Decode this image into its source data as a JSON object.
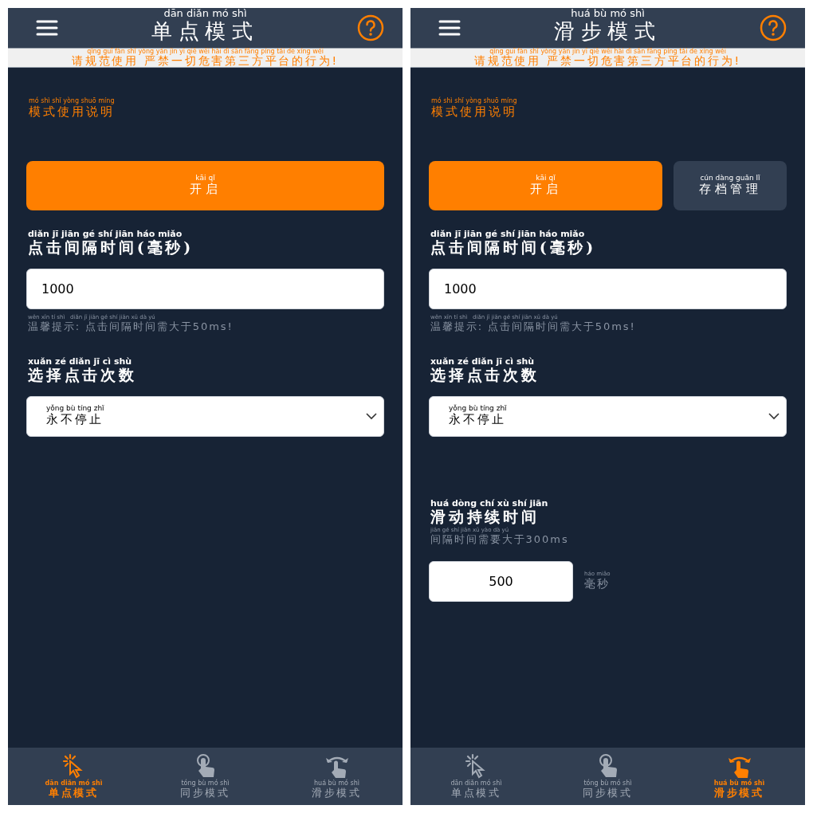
{
  "screens": [
    {
      "title": {
        "pinyin": "dān diǎn mó shì",
        "text": "单点模式"
      },
      "notice": {
        "pinyin": "qǐng guī fàn shǐ yòng yán jìn yī qiē wēi hài dì sān fāng píng tái de xíng wéi",
        "text": "请规范使用 严禁一切危害第三方平台的行为!"
      },
      "help_link": {
        "pinyin": "mó shì shǐ yòng shuō míng",
        "text": "模式使用说明"
      },
      "buttons": [
        {
          "pinyin": "kāi qǐ",
          "text": "开启",
          "kind": "primary"
        }
      ],
      "interval": {
        "label": {
          "pinyin": "diǎn jī jiān gé shí jiān háo miǎo",
          "text": "点击间隔时间(毫秒)"
        },
        "value": "1000",
        "hint": {
          "pinyin": "wēn xīn tí shì   diǎn jī jiān gé shí jiān xū dà yú",
          "text": "温馨提示: 点击间隔时间需大于50ms!"
        }
      },
      "click_count": {
        "label": {
          "pinyin": "xuǎn zé diǎn jī cì shù",
          "text": "选择点击次数"
        },
        "value": {
          "pinyin": "yǒng bù tíng zhǐ",
          "text": "永不停止"
        }
      },
      "tabs": [
        {
          "kind": "tap",
          "pinyin": "dān diǎn mó shì",
          "text": "单点模式",
          "selected": true
        },
        {
          "kind": "touch",
          "pinyin": "tóng bù mó shì",
          "text": "同步模式",
          "selected": false
        },
        {
          "kind": "swipe",
          "pinyin": "huá bù mó shì",
          "text": "滑步模式",
          "selected": false
        }
      ]
    },
    {
      "title": {
        "pinyin": "huá bù mó shì",
        "text": "滑步模式"
      },
      "notice": {
        "pinyin": "qǐng guī fàn shǐ yòng yán jìn yī qiē wēi hài dì sān fāng píng tái de xíng wéi",
        "text": "请规范使用 严禁一切危害第三方平台的行为!"
      },
      "help_link": {
        "pinyin": "mó shì shǐ yòng shuō míng",
        "text": "模式使用说明"
      },
      "buttons": [
        {
          "pinyin": "kāi qǐ",
          "text": "开启",
          "kind": "primary"
        },
        {
          "pinyin": "cún dàng guǎn lǐ",
          "text": "存档管理",
          "kind": "secondary"
        }
      ],
      "interval": {
        "label": {
          "pinyin": "diǎn jī jiān gé shí jiān háo miǎo",
          "text": "点击间隔时间(毫秒)"
        },
        "value": "1000",
        "hint": {
          "pinyin": "wēn xīn tí shì   diǎn jī jiān gé shí jiān xū dà yú",
          "text": "温馨提示: 点击间隔时间需大于50ms!"
        }
      },
      "click_count": {
        "label": {
          "pinyin": "xuǎn zé diǎn jī cì shù",
          "text": "选择点击次数"
        },
        "value": {
          "pinyin": "yǒng bù tíng zhǐ",
          "text": "永不停止"
        }
      },
      "swipe_duration": {
        "label": {
          "pinyin": "huá dòng chí xù shí jiān",
          "text": "滑动持续时间"
        },
        "hint": {
          "pinyin": "jiān gé shí jiān xū yào dà yú",
          "text": "间隔时间需要大于300ms"
        },
        "value": "500",
        "unit": {
          "pinyin": "háo miǎo",
          "text": "毫秒"
        }
      },
      "tabs": [
        {
          "kind": "tap",
          "pinyin": "dān diǎn mó shì",
          "text": "单点模式",
          "selected": false
        },
        {
          "kind": "touch",
          "pinyin": "tóng bù mó shì",
          "text": "同步模式",
          "selected": false
        },
        {
          "kind": "swipe",
          "pinyin": "huá bù mó shì",
          "text": "滑步模式",
          "selected": true
        }
      ]
    }
  ]
}
